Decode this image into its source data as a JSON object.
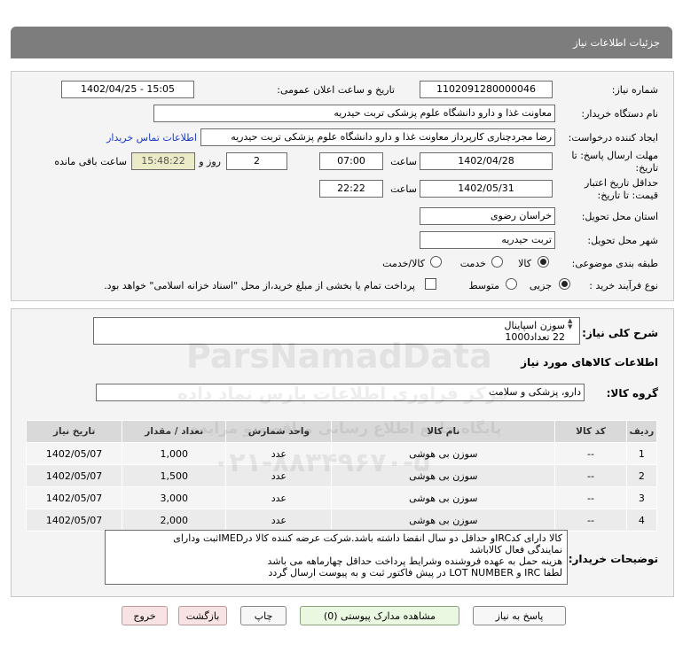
{
  "page_title": "جزئیات اطلاعات نیاز",
  "fields": {
    "need_number_label": "شماره نیاز:",
    "need_number": "1102091280000046",
    "announce_label": "تاریخ و ساعت اعلان عمومی:",
    "announce_value": "1402/04/25 - 15:05",
    "buyer_org_label": "نام دستگاه خریدار:",
    "buyer_org": "معاونت غذا و دارو   دانشگاه علوم پزشکی تربت حیدریه",
    "requester_label": "ایجاد کننده درخواست:",
    "requester": "رضا مجردچناری کارپرداز معاونت غذا و دارو   دانشگاه علوم پزشکی تربت حیدریه",
    "contact_link": "اطلاعات تماس خریدار",
    "deadline_label_1": "مهلت ارسال پاسخ: تا",
    "deadline_label_2": "تاریخ:",
    "deadline_date": "1402/04/28",
    "time_label": "ساعت",
    "deadline_time": "07:00",
    "days_value": "2",
    "days_label": "روز و",
    "remaining_time": "15:48:22",
    "remaining_label": "ساعت باقی مانده",
    "validity_label_1": "حداقل تاریخ اعتبار",
    "validity_label_2": "قیمت: تا تاریخ:",
    "validity_date": "1402/05/31",
    "validity_time_label": "ساعت",
    "validity_time": "22:22",
    "province_label": "استان محل تحویل:",
    "province": "خراسان رضوی",
    "city_label": "شهر محل تحویل:",
    "city": "تربت حیدریه",
    "category_label": "طبقه بندی موضوعی:",
    "category_options": [
      "کالا",
      "خدمت",
      "کالا/خدمت"
    ],
    "category_selected": "کالا",
    "process_label": "نوع فرآیند خرید :",
    "process_options": [
      "جزیی",
      "متوسط"
    ],
    "process_selected": "جزیی",
    "payment_note": "پرداخت تمام یا بخشی از مبلغ خرید،از محل \"اسناد خزانه اسلامی\" خواهد بود."
  },
  "summary": {
    "label": "شرح کلی نیاز:",
    "line1": "سوزن اسپاینال",
    "line2": "22 تعداد1000"
  },
  "goods_section_title": "اطلاعات کالاهای مورد نیاز",
  "goods_group_label": "گروه کالا:",
  "goods_group": "دارو، پزشکی و سلامت",
  "table": {
    "headers": [
      "ردیف",
      "کد کالا",
      "نام کالا",
      "واحد شمارش",
      "تعداد / مقدار",
      "تاریخ نیاز"
    ],
    "rows": [
      [
        "1",
        "--",
        "سوزن بی هوشی",
        "عدد",
        "1,000",
        "1402/05/07"
      ],
      [
        "2",
        "--",
        "سوزن بی هوشی",
        "عدد",
        "1,500",
        "1402/05/07"
      ],
      [
        "3",
        "--",
        "سوزن بی هوشی",
        "عدد",
        "3,000",
        "1402/05/07"
      ],
      [
        "4",
        "--",
        "سوزن بی هوشی",
        "عدد",
        "2,000",
        "1402/05/07"
      ]
    ]
  },
  "buyer_notes": {
    "label": "توضیحات خریدار:",
    "lines": [
      "کالا دارای کدIRCو حداقل دو سال انقضا داشته باشد.شرکت عرضه کننده کالا درIMEDثبت ودارای",
      "نمایندگی فعال کالاباشد",
      "هزینه حمل به عهده فروشنده وشرایط پرداخت حداقل چهارماهه می باشد",
      "لطفا IRC و LOT NUMBER در پیش فاکتور ثبت و به پیوست ارسال گردد"
    ]
  },
  "buttons": {
    "reply": "پاسخ به نیاز",
    "attachments": "مشاهده مدارک پیوستی (0)",
    "print": "چاپ",
    "back": "بازگشت",
    "exit": "خروج"
  },
  "watermark": {
    "brand": "ParsNamadData",
    "line1": "مرکز فراوری اطلاعات پارس نماد داده",
    "line2": "پایگاه جامع اطلاع رسانی مناقصه و مزایده",
    "phone": "۰۲۱-۸۸۳۴۹۶۷۰-۵"
  }
}
